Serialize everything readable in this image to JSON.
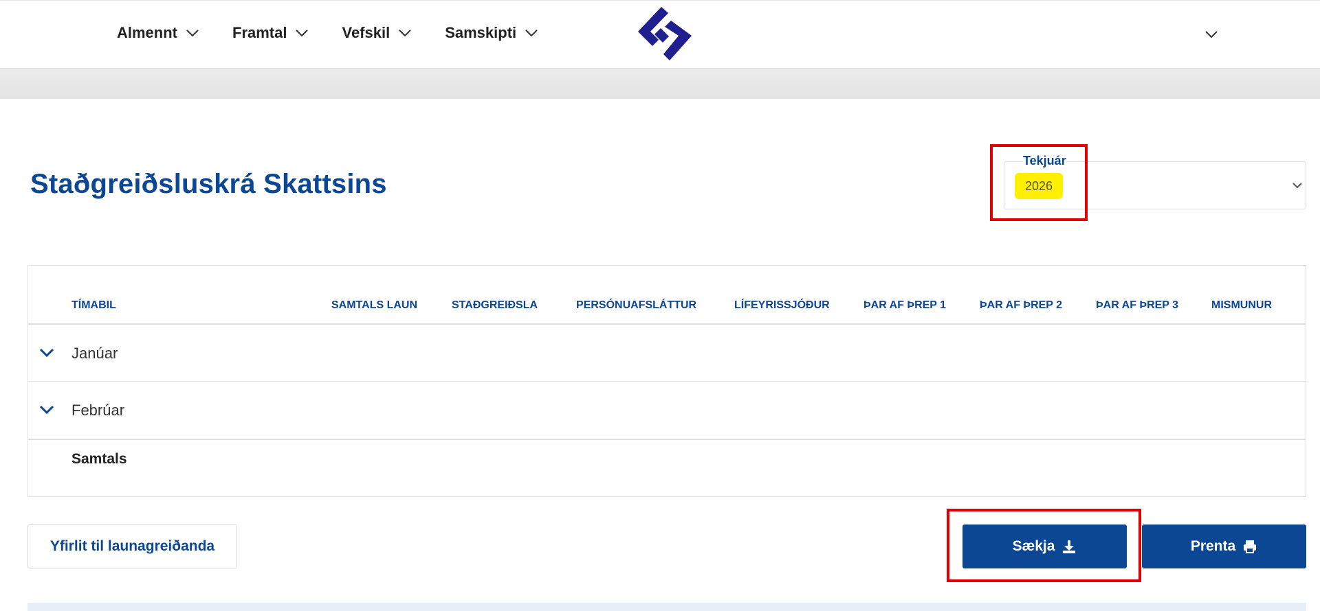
{
  "header": {
    "nav": [
      {
        "label": "Almennt"
      },
      {
        "label": "Framtal"
      },
      {
        "label": "Vefskil"
      },
      {
        "label": "Samskipti"
      }
    ],
    "logo_icon": "skatturinn-logo-icon",
    "user_menu_icon": "chevron-down-icon"
  },
  "page": {
    "title": "Staðgreiðsluskrá Skattsins"
  },
  "year_select": {
    "label": "Tekjuár",
    "value": "2026"
  },
  "table": {
    "columns": [
      "TÍMABIL",
      "SAMTALS LAUN",
      "STAÐGREIÐSLA",
      "PERSÓNUAFSLÁTTUR",
      "LÍFEYRISSJÓÐUR",
      "ÞAR AF ÞREP 1",
      "ÞAR AF ÞREP 2",
      "ÞAR AF ÞREP 3",
      "MISMUNUR"
    ],
    "rows": [
      {
        "label": "Janúar"
      },
      {
        "label": "Febrúar"
      }
    ],
    "total_label": "Samtals"
  },
  "buttons": {
    "overview": "Yfirlit til launagreiðanda",
    "download": "Sækja",
    "print": "Prenta"
  },
  "colors": {
    "brand_blue": "#0c4794",
    "logo_blue": "#1f1f8f",
    "highlight_yellow": "#fff000",
    "annotation_red": "#e00000"
  }
}
